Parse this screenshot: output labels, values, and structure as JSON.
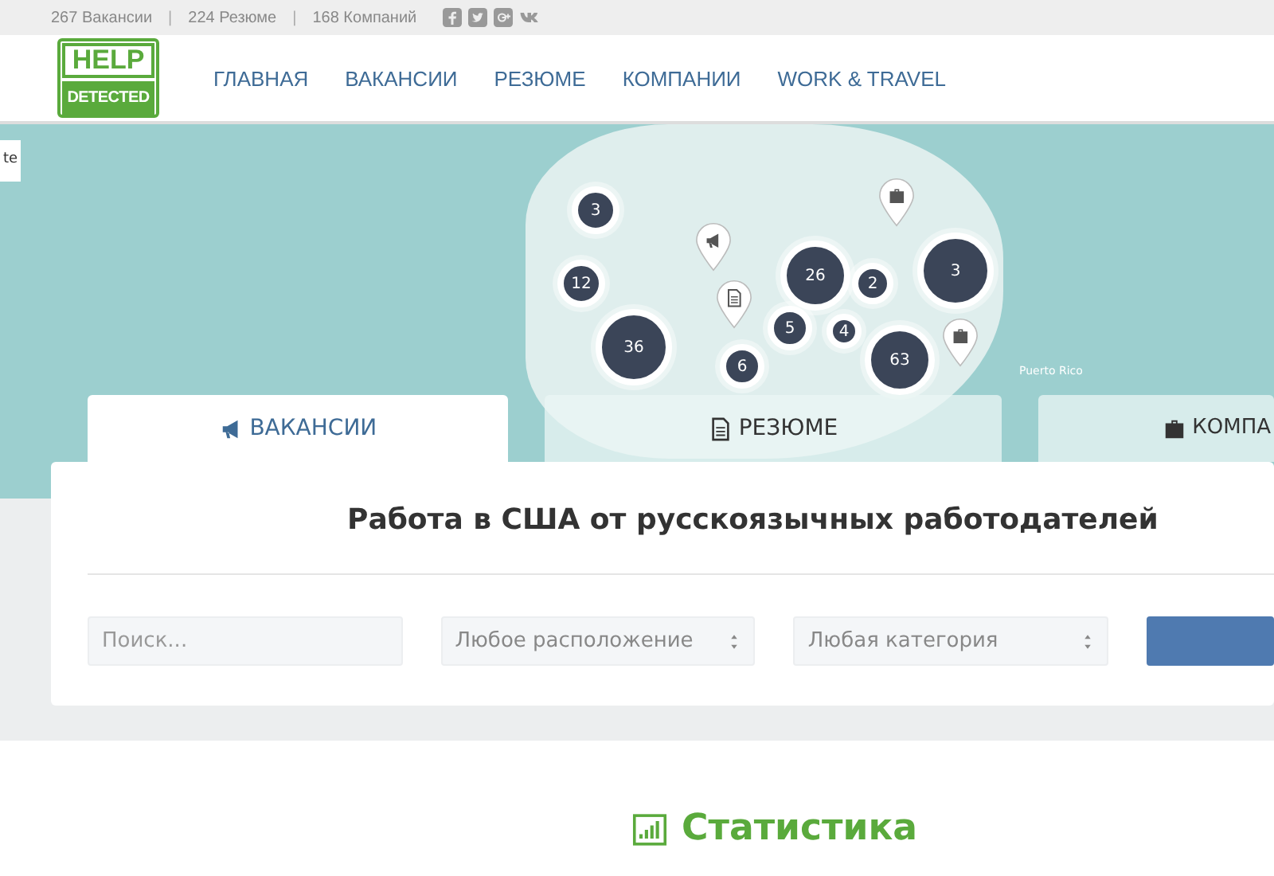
{
  "top_bar": {
    "stats": [
      "267 Вакансии",
      "224 Резюме",
      "168 Компаний"
    ],
    "separator": "|"
  },
  "logo": {
    "line_1": "HELP",
    "line_2": "DETECTED"
  },
  "nav": [
    {
      "label": "ГЛАВНАЯ"
    },
    {
      "label": "ВАКАНСИИ"
    },
    {
      "label": "РЕЗЮМЕ"
    },
    {
      "label": "КОМПАНИИ"
    },
    {
      "label": "WORK & TRAVEL"
    }
  ],
  "map": {
    "corner_label": "te",
    "clusters": [
      {
        "count": "3"
      },
      {
        "count": "12"
      },
      {
        "count": "36"
      },
      {
        "count": "26"
      },
      {
        "count": "5"
      },
      {
        "count": "3"
      },
      {
        "count": "2"
      },
      {
        "count": "4"
      },
      {
        "count": "6"
      },
      {
        "count": "63"
      }
    ],
    "pins": [
      {
        "kind": "megaphone"
      },
      {
        "kind": "document"
      },
      {
        "kind": "briefcase"
      },
      {
        "kind": "briefcase"
      }
    ],
    "attribution": "Puerto Rico"
  },
  "tabs": [
    {
      "label": "ВАКАНСИИ",
      "kind": "megaphone",
      "selected": true
    },
    {
      "label": "РЕЗЮМЕ",
      "kind": "document",
      "selected": false
    },
    {
      "label": "КОМПА",
      "kind": "briefcase",
      "selected": false
    }
  ],
  "search": {
    "title": "Работа в США от русскоязычных работодателей",
    "keyword": {
      "placeholder": "Поиск..."
    },
    "location": {
      "value": "Любое расположение"
    },
    "category": {
      "value": "Любая категория"
    }
  },
  "stats_section": {
    "title": "Статистика"
  }
}
